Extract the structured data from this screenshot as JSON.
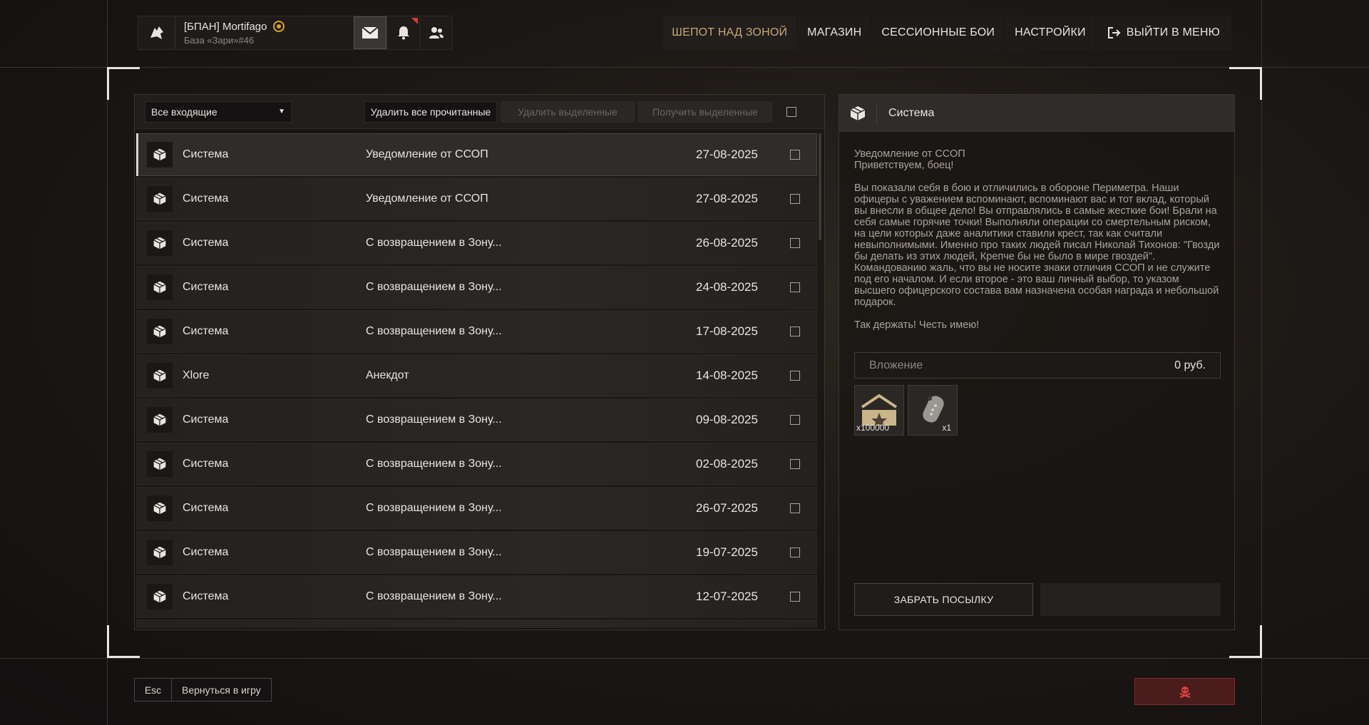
{
  "profile": {
    "name": "[БПАН] Mortifago",
    "base": "База «Зари»#46"
  },
  "nav": {
    "items": [
      {
        "label": "ШЕПОТ НАД ЗОНОЙ"
      },
      {
        "label": "МАГАЗИН"
      },
      {
        "label": "СЕССИОННЫЕ БОИ"
      },
      {
        "label": "НАСТРОЙКИ"
      },
      {
        "label": "ВЫЙТИ В МЕНЮ"
      }
    ]
  },
  "toolbar": {
    "filter": "Все входящие",
    "delete_read": "Удалить все прочитанные",
    "delete_selected": "Удалить выделенные",
    "receive_selected": "Получить выделенные"
  },
  "messages": [
    {
      "sender": "Система",
      "subject": "Уведомление от ССОП",
      "date": "27-08-2025"
    },
    {
      "sender": "Система",
      "subject": "Уведомление от ССОП",
      "date": "27-08-2025"
    },
    {
      "sender": "Система",
      "subject": "С возвращением в Зону...",
      "date": "26-08-2025"
    },
    {
      "sender": "Система",
      "subject": "С возвращением в Зону...",
      "date": "24-08-2025"
    },
    {
      "sender": "Система",
      "subject": "С возвращением в Зону...",
      "date": "17-08-2025"
    },
    {
      "sender": "Xlore",
      "subject": "Анекдот",
      "date": "14-08-2025"
    },
    {
      "sender": "Система",
      "subject": "С возвращением в Зону...",
      "date": "09-08-2025"
    },
    {
      "sender": "Система",
      "subject": "С возвращением в Зону...",
      "date": "02-08-2025"
    },
    {
      "sender": "Система",
      "subject": "С возвращением в Зону...",
      "date": "26-07-2025"
    },
    {
      "sender": "Система",
      "subject": "С возвращением в Зону...",
      "date": "19-07-2025"
    },
    {
      "sender": "Система",
      "subject": "С возвращением в Зону...",
      "date": "12-07-2025"
    }
  ],
  "detail": {
    "sender": "Система",
    "subject": "Уведомление от ССОП",
    "greeting": "Приветствуем, боец!",
    "body": "Вы показали себя в бою и отличились в обороне Периметра. Наши офицеры с уважением вспоминают, вспоминают вас и тот вклад, который вы внесли в общее дело! Вы отправлялись в самые жесткие бои! Брали на себя самые горячие точки! Выполняли операции со смертельным риском, на цели которых даже аналитики ставили крест, так как считали невыполнимыми. Именно про таких людей писал Николай Тихонов: \"Гвозди бы делать из этих людей, Крепче бы не было в мире гвоздей\". Командованию жаль, что вы не носите знаки отличия ССОП и не служите под его началом. И если второе - это ваш личный выбор, то указом высшего офицерского состава вам назначена особая награда и небольшой подарок.",
    "closing": "Так держать! Честь имею!",
    "attachment_label": "Вложение",
    "attachment_value": "0 руб.",
    "items": [
      {
        "icon": "reputation-icon",
        "qty": "x100000"
      },
      {
        "icon": "dog-tag-icon",
        "qty": "x1"
      }
    ],
    "claim_label": "ЗАБРАТЬ ПОСЫЛКУ"
  },
  "footer": {
    "esc_key": "Esc",
    "back_label": "Вернуться в игру"
  },
  "colors": {
    "accent": "#c6a877",
    "danger": "#7b2c2c"
  }
}
